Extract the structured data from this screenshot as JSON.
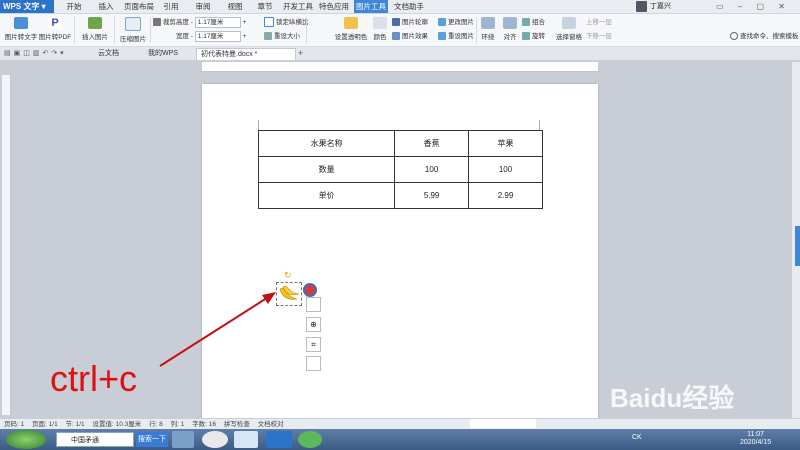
{
  "app": {
    "name": "WPS 文字"
  },
  "menu": {
    "tabs": [
      "开始",
      "插入",
      "页面布局",
      "引用",
      "审阅",
      "视图",
      "章节",
      "开发工具",
      "特色应用",
      "图片工具",
      "文档助手"
    ],
    "active": "图片工具"
  },
  "user": {
    "name": "丁嘉兴"
  },
  "ribbon": {
    "pic_to_text": "图片转文字",
    "pic_to_pdf": "图片转PDF",
    "insert_pic": "插入图片",
    "compress": "压缩图片",
    "crop": "裁剪",
    "height_label": "高度",
    "height_value": "1.17厘米",
    "width_label": "宽度",
    "width_value": "1.17厘米",
    "lock_ratio": "锁定纵横比",
    "reset_size": "重设大小",
    "set_transparent": "设置透明色",
    "color": "颜色",
    "pic_outline": "图片轮廓",
    "pic_effect": "图片效果",
    "change_pic": "更改图片",
    "reset_pic": "重设图片",
    "wrap": "环绕",
    "align": "对齐",
    "group": "组合",
    "rotate": "旋转",
    "select_pane": "选择窗格",
    "move_up": "上移一层",
    "move_down": "下移一层",
    "search": "查找命令、搜索模板"
  },
  "tabs": {
    "cloud": "云文档",
    "mywps": "我的WPS",
    "doc": "初代表特曼.docx *"
  },
  "table": {
    "rows": [
      [
        "水果名称",
        "香蕉",
        "苹果"
      ],
      [
        "数量",
        "100",
        "100"
      ],
      [
        "单价",
        "5.99",
        "2.99"
      ]
    ]
  },
  "annotation": {
    "text": "ctrl+c"
  },
  "status": {
    "page": "页码: 1",
    "pages": "页面: 1/1",
    "section": "节: 1/1",
    "setting": "设置值: 10.3厘米",
    "row": "行: 8",
    "col": "列: 1",
    "words": "字数: 16",
    "spell": "拼写检查",
    "proof": "文档校对"
  },
  "taskbar": {
    "search_value": "中国矛通",
    "search_btn": "搜索一下",
    "time": "11:07",
    "date": "2020/4/15",
    "ime": "CK"
  },
  "watermark": "Baidu经验",
  "colors": {
    "accent": "#3d86d9",
    "annotation": "#d11111"
  }
}
